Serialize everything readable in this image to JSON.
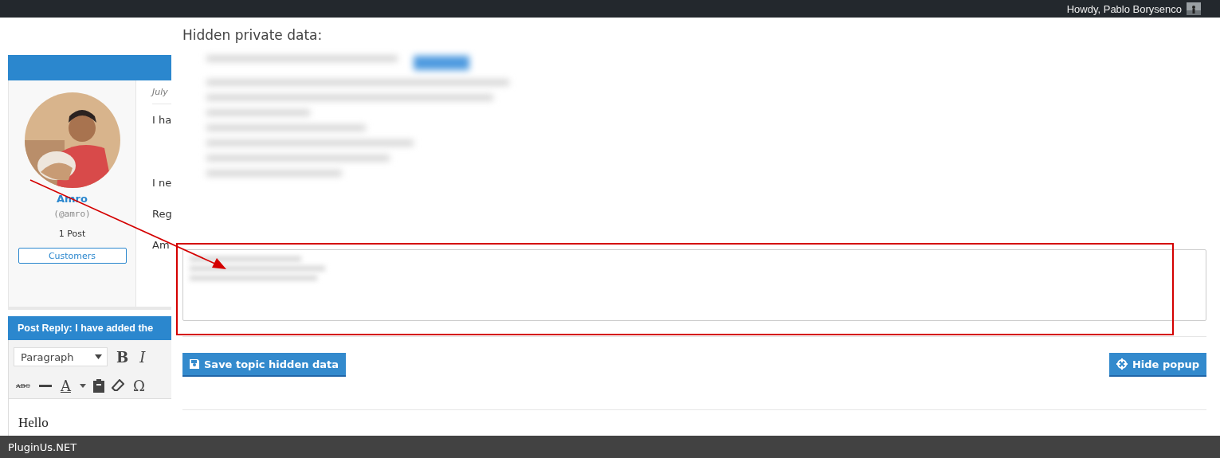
{
  "admin_bar": {
    "greeting": "Howdy, Pablo Borysenco"
  },
  "topic": {
    "date": "July",
    "lines": [
      "I ha",
      "I ne",
      "Reg",
      "Am"
    ],
    "author": {
      "name": "Amro",
      "handle": "(@amro)",
      "posts": "1 Post",
      "role": "Customers"
    }
  },
  "reply": {
    "title": "Post Reply: I have added the",
    "format": "Paragraph",
    "body": "Hello",
    "toolbar": [
      [
        {
          "kind": "bold",
          "label": "B"
        },
        {
          "kind": "italic",
          "label": "I"
        }
      ],
      [
        {
          "kind": "strike",
          "label": "ABC"
        },
        {
          "kind": "hr"
        },
        {
          "kind": "color",
          "label": "A"
        },
        {
          "kind": "paste"
        },
        {
          "kind": "eraser"
        },
        {
          "kind": "char",
          "label": "Ω"
        }
      ]
    ]
  },
  "popup": {
    "title": "Hidden private data:",
    "buttons": [
      {
        "kind": "save",
        "label": "Save topic hidden data"
      },
      {
        "kind": "hide",
        "label": "Hide popup"
      }
    ]
  },
  "footer": {
    "brand": "PluginUs.NET"
  }
}
